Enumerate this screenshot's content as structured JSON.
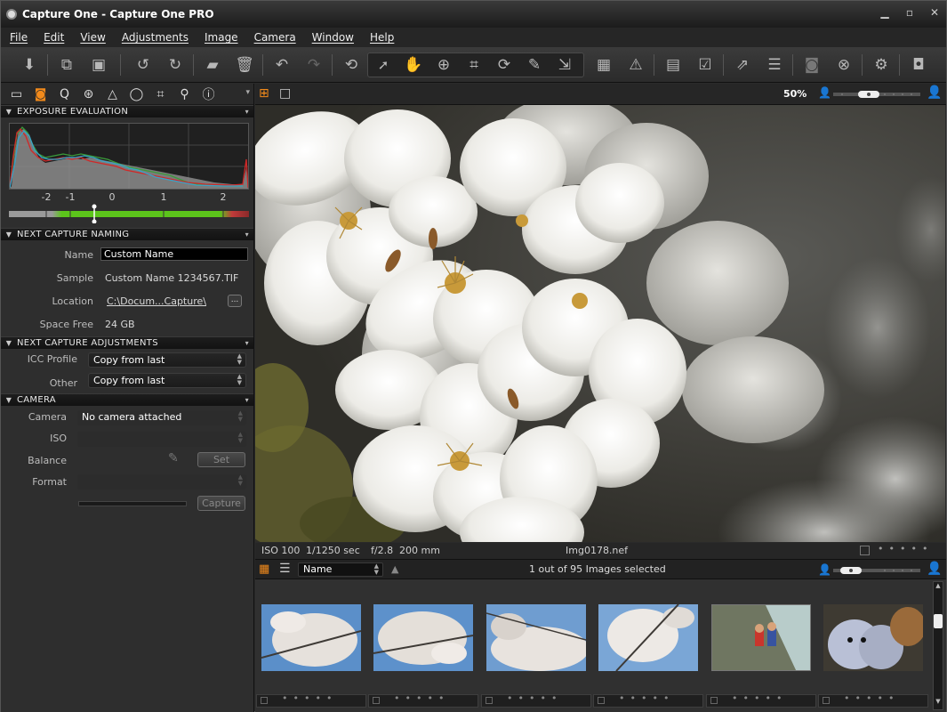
{
  "window": {
    "title": "Capture One - Capture One PRO"
  },
  "menu": [
    "File",
    "Edit",
    "View",
    "Adjustments",
    "Image",
    "Camera",
    "Window",
    "Help"
  ],
  "toolbar": {
    "icons": [
      "import-icon",
      "compare-icon",
      "fullscreen-icon",
      "rotate-left-icon",
      "rotate-right-icon",
      "move-to-folder-icon",
      "trash-icon",
      "undo-icon",
      "redo-icon",
      "reset-icon",
      "select-cursor-icon",
      "pan-hand-icon",
      "zoom-icon",
      "crop-icon",
      "straighten-icon",
      "color-picker-icon",
      "apply-adjustments-icon",
      "grid-icon",
      "exposure-warning-icon",
      "new-album-icon",
      "mark-icon",
      "process-icon",
      "batch-icon",
      "camera-icon",
      "cancel-icon",
      "settings-icon",
      "capture-icon"
    ]
  },
  "left_panel": {
    "tool_tabs": [
      "library-tab",
      "capture-tab",
      "quick-tab",
      "color-tab",
      "exposure-tab",
      "lens-tab",
      "composition-tab",
      "details-tab",
      "metadata-tab"
    ],
    "exposure": {
      "header": "EXPOSURE EVALUATION",
      "ticks": [
        "-2",
        "-1",
        "0",
        "1",
        "2"
      ],
      "level_ev": -0.1
    },
    "naming": {
      "header": "NEXT CAPTURE NAMING",
      "name_label": "Name",
      "name_value": "Custom Name",
      "sample_label": "Sample",
      "sample_value": "Custom Name 1234567.TIF",
      "location_label": "Location",
      "location_value": "C:\\Docum...Capture\\",
      "browse_label": "...",
      "space_label": "Space Free",
      "space_value": "24 GB"
    },
    "adjustments": {
      "header": "NEXT CAPTURE ADJUSTMENTS",
      "icc_label": "ICC Profile",
      "icc_value": "Copy from last",
      "other_label": "Other",
      "other_value": "Copy from last"
    },
    "camera": {
      "header": "CAMERA",
      "camera_label": "Camera",
      "camera_value": "No camera attached",
      "iso_label": "ISO",
      "balance_label": "Balance",
      "set_label": "Set",
      "format_label": "Format",
      "capture_label": "Capture"
    }
  },
  "viewer": {
    "zoom": "50%",
    "iso": "ISO 100",
    "shutter": "1/1250 sec",
    "aperture": "f/2.8",
    "focal": "200 mm",
    "filename": "Img0178.nef"
  },
  "browser": {
    "sort_label": "Name",
    "status": "1 out of 95 Images selected",
    "thumbnails": [
      "cherry-blossom-1",
      "cherry-blossom-2",
      "cherry-blossom-3",
      "cherry-blossom-4",
      "toy-figures",
      "plush-toys"
    ]
  },
  "colors": {
    "accent": "#f28a1b",
    "ev_green": "#5cc41b",
    "ev_red": "#c03a3a"
  }
}
